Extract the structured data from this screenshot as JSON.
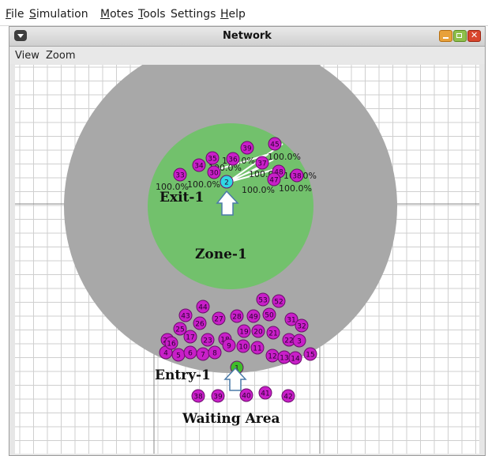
{
  "menubar": {
    "items": [
      {
        "label": "File",
        "mnemonic": "F",
        "rest": "ile"
      },
      {
        "label": "Simulation",
        "mnemonic": "S",
        "rest": "imulation"
      },
      {
        "label": "Motes",
        "mnemonic": "M",
        "rest": "otes"
      },
      {
        "label": "Tools",
        "mnemonic": "T",
        "rest": "ools"
      },
      {
        "label": "Settings",
        "mnemonic": "",
        "rest": "Settings"
      },
      {
        "label": "Help",
        "mnemonic": "H",
        "rest": "elp"
      }
    ]
  },
  "window": {
    "title": "Network",
    "menu": {
      "view": "View",
      "zoom": "Zoom"
    }
  },
  "network": {
    "colors": {
      "background": "#ffffff",
      "grid": "#cfcfcf",
      "interference_zone": "#a8a8a8",
      "transmission_zone": "#72c16c",
      "mote_fill": "#c81fc8",
      "mote_stroke": "#6a0d6a",
      "selected_mote": "#2fd8e4",
      "entry_mote": "#3fbd2a",
      "link_line": "#ffffff"
    },
    "labels": {
      "exit": "Exit-1",
      "zone": "Zone-1",
      "entry": "Entry-1",
      "waiting_area": "Waiting Area"
    },
    "link_percentages": [
      "100.0%",
      "100.0%",
      "100.0%",
      "100.0%",
      "100.0%",
      "100.0%",
      "100.0%",
      "100.0%",
      "100.0%"
    ],
    "selected_mote": "2",
    "entry_mote": "1",
    "exit_cluster_motes": [
      "33",
      "34",
      "35",
      "36",
      "39",
      "45",
      "37",
      "48",
      "47",
      "38",
      "30"
    ],
    "entry_cluster_motes": [
      "44",
      "43",
      "53",
      "52",
      "26",
      "27",
      "28",
      "49",
      "50",
      "31",
      "32",
      "25",
      "24",
      "17",
      "23",
      "18",
      "19",
      "20",
      "21",
      "22",
      "3",
      "4",
      "5",
      "6",
      "7",
      "8",
      "9",
      "10",
      "11",
      "12",
      "13",
      "14",
      "15",
      "16"
    ],
    "waiting_motes": [
      "38",
      "39",
      "40",
      "41",
      "42"
    ]
  }
}
